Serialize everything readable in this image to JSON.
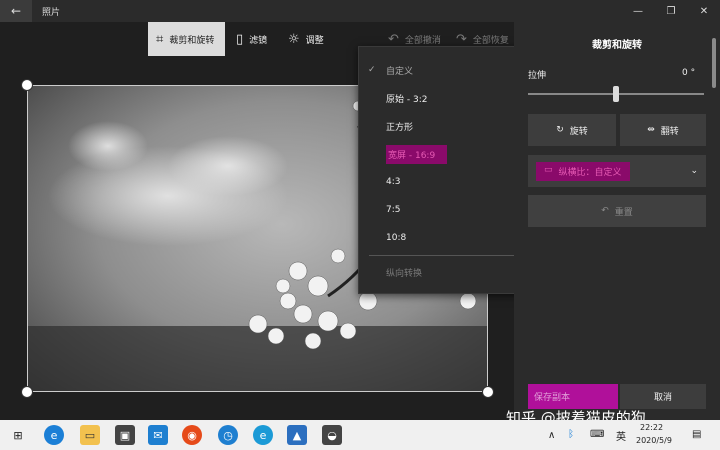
{
  "window": {
    "title": "照片",
    "back_icon": "back-arrow-icon"
  },
  "toolbar": {
    "crop_rotate": "裁剪和旋转",
    "filters": "滤镜",
    "adjust": "调整",
    "undo_all": "全部撤消",
    "redo_all": "全部恢复"
  },
  "aspect_menu": {
    "items": [
      "自定义",
      "原始 - 3:2",
      "正方形",
      "宽屏 - 16:9",
      "4:3",
      "7:5",
      "10:8"
    ],
    "selected": "自定义",
    "orientation": "纵向转换"
  },
  "panel": {
    "title": "裁剪和旋转",
    "straighten_label": "拉伸",
    "straighten_value": "0 °",
    "straighten_level": 0.5,
    "rotate": "旋转",
    "flip": "翻转",
    "aspect_ratio": "纵横比：自定义",
    "reset": "重置",
    "save": "保存副本",
    "cancel": "取消"
  },
  "watermark": "知乎 @披着猫皮的狗",
  "taskbar": {
    "ime": "英",
    "time": "22:22",
    "date": "2020/5/9"
  },
  "colors": {
    "highlight": "#8a0a6a",
    "accent": "#b0109a"
  }
}
